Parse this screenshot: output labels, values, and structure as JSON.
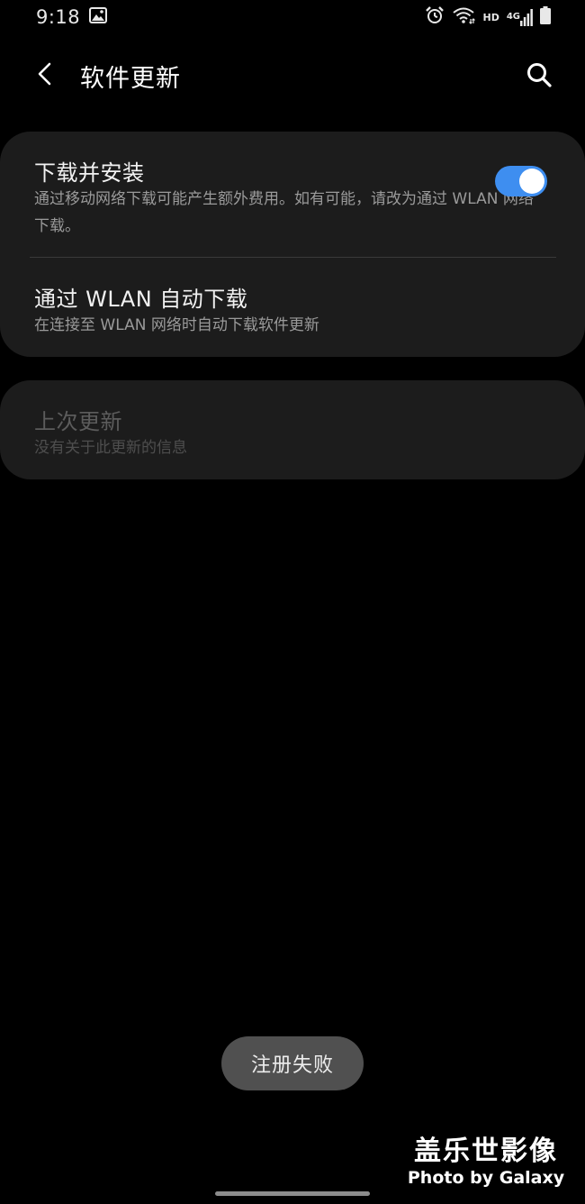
{
  "status_bar": {
    "time": "9:18",
    "hd_label": "HD",
    "network_label": "4G"
  },
  "app_bar": {
    "title": "软件更新"
  },
  "settings": {
    "download_install": {
      "title": "下载并安装",
      "subtitle": "通过移动网络下载可能产生额外费用。如有可能，请改为通过 WLAN 网络下载。"
    },
    "auto_download_wlan": {
      "title": "通过 WLAN 自动下载",
      "subtitle": "在连接至 WLAN 网络时自动下载软件更新",
      "enabled": true
    },
    "last_update": {
      "title": "上次更新",
      "subtitle": "没有关于此更新的信息",
      "disabled": true
    }
  },
  "toast": {
    "message": "注册失败"
  },
  "watermark": {
    "line1": "盖乐世影像",
    "line2": "Photo by Galaxy"
  },
  "colors": {
    "background": "#000000",
    "card": "#1c1c1c",
    "accent": "#3e8ef0",
    "toast": "#505050"
  }
}
